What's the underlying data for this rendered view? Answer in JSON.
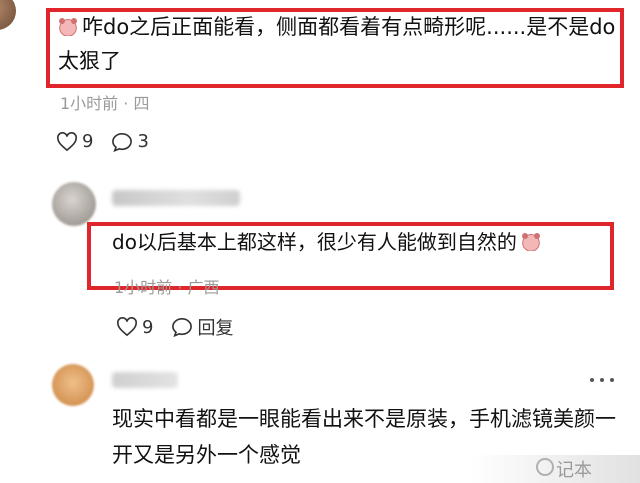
{
  "comments": [
    {
      "text": "咋do之后正面能看，侧面都看着有点畸形呢......是不是do太狠了",
      "meta": "1小时前 · 四",
      "likes": "9",
      "replies": "3"
    },
    {
      "text": "do以后基本上都这样，很少有人能做到自然的",
      "meta": "1小时前 · 广西",
      "likes": "9",
      "reply_label": "回复"
    },
    {
      "text": "现实中看都是一眼能看出来不是原装，手机滤镜美颜一开又是另外一个感觉"
    }
  ],
  "watermark": "记本",
  "colors": {
    "highlight": "#e0262b"
  }
}
